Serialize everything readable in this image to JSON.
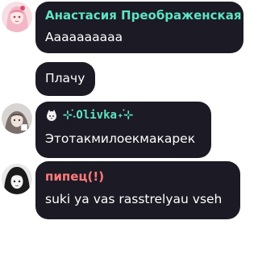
{
  "messages": [
    {
      "author": "Анастасия Преображенская",
      "author_color": "#5ee3c4",
      "lines": [
        "Аааааааааа",
        "Плачу"
      ]
    },
    {
      "author": "⊹˖֗Olivka˖֗⊹",
      "author_color": "#5ee3c4",
      "badge_icon": "cat-badge-icon",
      "lines": [
        "Этотакмилоекмакарек"
      ]
    },
    {
      "author": "пипец(!)",
      "author_color": "#ff7b7b",
      "lines": [
        "suki ya vas rasstrelyau vseh"
      ]
    }
  ],
  "colors": {
    "bubble_bg": "#1c1a24",
    "text": "#ffffff",
    "page_bg": "#ffffff"
  }
}
